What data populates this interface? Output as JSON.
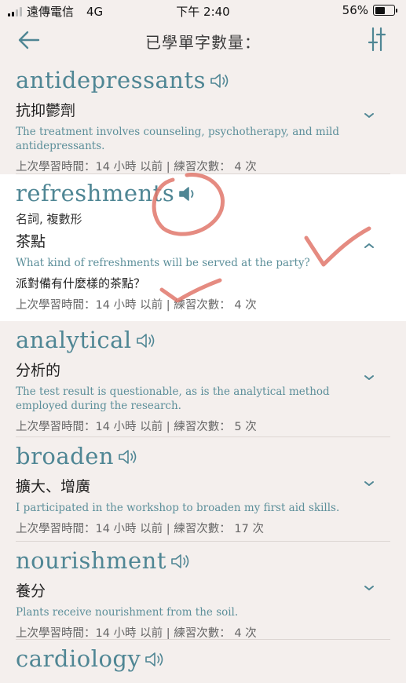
{
  "status": {
    "carrier": "遠傳電信",
    "network": "4G",
    "time": "下午 2:40",
    "battery_percent": "56%",
    "battery_level": 0.56
  },
  "nav": {
    "title": "已學單字數量：",
    "back_icon": "back-arrow-icon",
    "filter_icon": "sliders-icon"
  },
  "colors": {
    "background": "#f4efed",
    "word": "#4f8694",
    "example": "#5c8f9a",
    "annotation": "#e0776b"
  },
  "words": [
    {
      "word": "antidepressants",
      "pos": "",
      "meaning": "抗抑鬱劑",
      "example": "The treatment involves counseling, psychotherapy, and mild antidepressants.",
      "example_translation": "",
      "last_study": "上次學習時間：14 小時 以前",
      "practice": "練習次數： 4 次",
      "expanded": false
    },
    {
      "word": "refreshments",
      "pos": "名詞, 複數形",
      "meaning": "茶點",
      "example": "What kind of refreshments will be served at the party?",
      "example_translation": "派對備有什麼樣的茶點？",
      "last_study": "上次學習時間：14 小時 以前",
      "practice": "練習次數： 4 次",
      "expanded": true
    },
    {
      "word": "analytical",
      "pos": "",
      "meaning": "分析的",
      "example": "The test result is questionable, as is the analytical method employed during the research.",
      "example_translation": "",
      "last_study": "上次學習時間：14 小時 以前",
      "practice": "練習次數： 5 次",
      "expanded": false
    },
    {
      "word": "broaden",
      "pos": "",
      "meaning": "擴大、增廣",
      "example": "I participated in the workshop to broaden my first aid skills.",
      "example_translation": "",
      "last_study": "上次學習時間：14 小時 以前",
      "practice": "練習次數： 17 次",
      "expanded": false
    },
    {
      "word": "nourishment",
      "pos": "",
      "meaning": "養分",
      "example": "Plants receive nourishment from the soil.",
      "example_translation": "",
      "last_study": "上次學習時間：14 小時 以前",
      "practice": "練習次數： 4 次",
      "expanded": false
    },
    {
      "word": "cardiology",
      "pos": "",
      "meaning": "",
      "example": "",
      "example_translation": "",
      "last_study": "",
      "practice": "",
      "expanded": false
    }
  ]
}
